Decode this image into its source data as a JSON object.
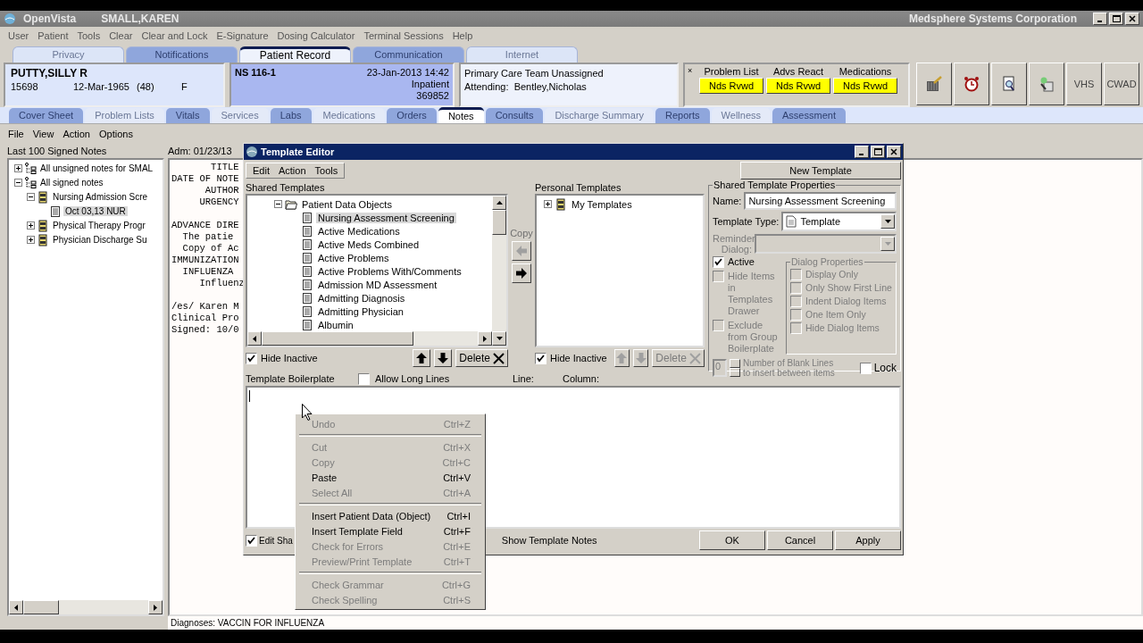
{
  "app_window": {
    "app_name": "OpenVista",
    "user": "SMALL,KAREN",
    "org": "Medsphere Systems Corporation"
  },
  "menu": [
    "User",
    "Patient",
    "Tools",
    "Clear",
    "Clear and Lock",
    "E-Signature",
    "Dosing Calculator",
    "Terminal Sessions",
    "Help"
  ],
  "top_tabs": [
    {
      "label": "Privacy",
      "selected": false
    },
    {
      "label": "Notifications",
      "selected": false
    },
    {
      "label": "Patient Record",
      "selected": true
    },
    {
      "label": "Communication",
      "selected": false
    },
    {
      "label": "Internet",
      "selected": false
    }
  ],
  "patient": {
    "name": "PUTTY,SILLY R",
    "id": "15698",
    "dob": "12-Mar-1965",
    "age": "(48)",
    "sex": "F"
  },
  "location": {
    "room": "NS  116-1",
    "datetime": "23-Jan-2013 14:42",
    "status": "Inpatient",
    "number": "369852"
  },
  "team": {
    "line_1": "Primary Care Team Unassigned",
    "line_2": "Attending:  Bentley,Nicholas"
  },
  "postings": {
    "close": "×",
    "items": [
      {
        "label": "Problem List",
        "button": "Nds Rvwd"
      },
      {
        "label": "Advs React",
        "button": "Nds Rvwd"
      },
      {
        "label": "Medications",
        "button": "Nds Rvwd"
      }
    ]
  },
  "text_tools": [
    "VHS",
    "CWAD"
  ],
  "chart_tabs": [
    {
      "label": "Cover Sheet",
      "selected": false
    },
    {
      "label": "Problem Lists",
      "selected": false
    },
    {
      "label": "Vitals",
      "selected": false
    },
    {
      "label": "Services",
      "selected": false
    },
    {
      "label": "Labs",
      "selected": false
    },
    {
      "label": "Medications",
      "selected": false
    },
    {
      "label": "Orders",
      "selected": false
    },
    {
      "label": "Notes",
      "selected": true
    },
    {
      "label": "Consults",
      "selected": false
    },
    {
      "label": "Discharge Summary",
      "selected": false
    },
    {
      "label": "Reports",
      "selected": false
    },
    {
      "label": "Wellness",
      "selected": false
    },
    {
      "label": "Assessment",
      "selected": false
    }
  ],
  "notes_menu": [
    "File",
    "View",
    "Action",
    "Options"
  ],
  "notes_tree": {
    "label": "Last 100 Signed Notes",
    "items": [
      {
        "label": "All unsigned notes for SMAL",
        "expanded": false,
        "selected": false
      },
      {
        "label": "All signed notes",
        "expanded": true,
        "selected": false,
        "children": [
          {
            "label": "Nursing Admission Scre",
            "expanded": true,
            "selected": false,
            "children": [
              {
                "label": "Oct 03,13  NUR",
                "selected": true
              }
            ]
          },
          {
            "label": "Physical Therapy Progr",
            "expanded": false,
            "selected": false
          },
          {
            "label": "Physician Discharge Su",
            "expanded": false,
            "selected": false
          }
        ]
      }
    ]
  },
  "note": {
    "header": "Adm: 01/23/13",
    "blocks": [
      [
        "       TITLE",
        "DATE OF NOTE",
        "      AUTHOR",
        "     URGENCY"
      ],
      [
        "ADVANCE DIRE",
        "  The patie",
        "  Copy of Ac",
        "IMMUNIZATION",
        "  INFLUENZA",
        "     Influenz"
      ],
      [
        "/es/ Karen M",
        "Clinical Pro",
        "Signed: 10/0"
      ]
    ]
  },
  "status": "Diagnoses: VACCIN FOR INFLUENZA",
  "template_editor": {
    "title": "Template Editor",
    "menu": [
      "Edit",
      "Action",
      "Tools"
    ],
    "new_button": "New Template",
    "shared": {
      "label": "Shared Templates",
      "folder": {
        "label": "Patient Data Objects",
        "expanded": true,
        "selected": false,
        "children": [
          {
            "label": "Nursing Assessment Screening",
            "selected": true
          },
          {
            "label": "Active Medications",
            "selected": false
          },
          {
            "label": "Active Meds Combined",
            "selected": false
          },
          {
            "label": "Active Problems",
            "selected": false
          },
          {
            "label": "Active Problems With/Comments",
            "selected": false
          },
          {
            "label": "Admission MD Assessment",
            "selected": false
          },
          {
            "label": "Admitting Diagnosis",
            "selected": false
          },
          {
            "label": "Admitting Physician",
            "selected": false
          },
          {
            "label": "Albumin",
            "selected": false
          }
        ]
      },
      "hide_inactive": {
        "label": "Hide Inactive",
        "checked": true
      },
      "buttons_disabled": false,
      "delete": "Delete"
    },
    "copy": {
      "label": "Copy",
      "left_disabled": true,
      "right_disabled": false
    },
    "personal": {
      "label": "Personal Templates",
      "items": [
        {
          "label": "My Templates",
          "expanded": false,
          "selected": false
        }
      ],
      "hide_inactive": {
        "label": "Hide Inactive",
        "checked": true
      },
      "buttons_disabled": true,
      "delete": "Delete"
    },
    "properties": {
      "title": "Shared Template Properties",
      "name_label": "Name:",
      "name_value": "Nursing Assessment Screening",
      "type_label": "Template Type:",
      "type_value": "Template",
      "reminder_label": "Reminder Dialog:",
      "reminder_disabled": true,
      "checks": [
        {
          "label": "Active",
          "checked": true,
          "disabled": false
        },
        {
          "label": "Hide Items in Templates Drawer",
          "checked": false,
          "disabled": true
        },
        {
          "label": "Exclude from Group Boilerplate",
          "checked": false,
          "disabled": true
        }
      ],
      "dialog_title": "Dialog Properties",
      "dialog_checks": [
        {
          "label": "Display Only",
          "checked": false,
          "disabled": true
        },
        {
          "label": "Only Show First Line",
          "checked": false,
          "disabled": true
        },
        {
          "label": "Indent Dialog Items",
          "checked": false,
          "disabled": true
        },
        {
          "label": "One Item Only",
          "checked": false,
          "disabled": true
        },
        {
          "label": "Hide Dialog Items",
          "checked": false,
          "disabled": true
        }
      ],
      "blank_lines_value": "0",
      "blank_lines_label": "Number of Blank Lines to insert between items",
      "lock": {
        "label": "Lock",
        "checked": false
      }
    },
    "boilerplate": {
      "label": "Template Boilerplate",
      "allow_long": {
        "label": "Allow Long Lines",
        "checked": false
      },
      "line_label": "Line:",
      "column_label": "Column:"
    },
    "edit_shared": {
      "label": "Edit Sha",
      "checked": true
    },
    "show_notes": "Show Template Notes",
    "buttons": [
      "OK",
      "Cancel",
      "Apply"
    ]
  },
  "context_menu": {
    "groups": [
      [
        {
          "label": "Undo",
          "shortcut": "Ctrl+Z",
          "disabled": true
        }
      ],
      [
        {
          "label": "Cut",
          "shortcut": "Ctrl+X",
          "disabled": true
        },
        {
          "label": "Copy",
          "shortcut": "Ctrl+C",
          "disabled": true
        },
        {
          "label": "Paste",
          "shortcut": "Ctrl+V",
          "disabled": false
        },
        {
          "label": "Select All",
          "shortcut": "Ctrl+A",
          "disabled": true
        }
      ],
      [
        {
          "label": "Insert Patient Data (Object)",
          "shortcut": "Ctrl+I",
          "disabled": false
        },
        {
          "label": "Insert Template Field",
          "shortcut": "Ctrl+F",
          "disabled": false
        },
        {
          "label": "Check for Errors",
          "shortcut": "Ctrl+E",
          "disabled": true
        },
        {
          "label": "Preview/Print Template",
          "shortcut": "Ctrl+T",
          "disabled": true
        }
      ],
      [
        {
          "label": "Check Grammar",
          "shortcut": "Ctrl+G",
          "disabled": true
        },
        {
          "label": "Check Spelling",
          "shortcut": "Ctrl+S",
          "disabled": true
        }
      ]
    ]
  }
}
